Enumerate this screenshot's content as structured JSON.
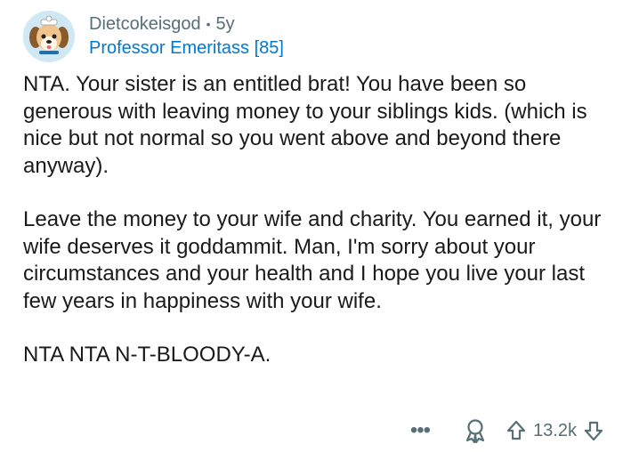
{
  "comment": {
    "username": "Dietcokeisgod",
    "separator": "•",
    "age": "5y",
    "flair": "Professor Emeritass [85]",
    "paragraphs": [
      "NTA. Your sister is an entitled brat! You have been so generous with leaving money to your siblings kids. (which is nice but not normal so you went above and beyond there anyway).",
      "Leave the money to your wife and charity. You earned it, your wife deserves it goddammit. Man, I'm sorry about your circumstances and your health and I hope you live your last few years in happiness with your wife.",
      "NTA NTA N-T-BLOODY-A."
    ]
  },
  "actions": {
    "more_label": "•••",
    "score": "13.2k"
  },
  "icons": {
    "avatar": "dog-avatar-icon",
    "more": "more-options-icon",
    "award": "award-icon",
    "upvote": "upvote-arrow-icon",
    "downvote": "downvote-arrow-icon"
  },
  "colors": {
    "meta_gray": "#576f76",
    "flair_blue": "#0079d3",
    "text": "#1a1a1b"
  }
}
